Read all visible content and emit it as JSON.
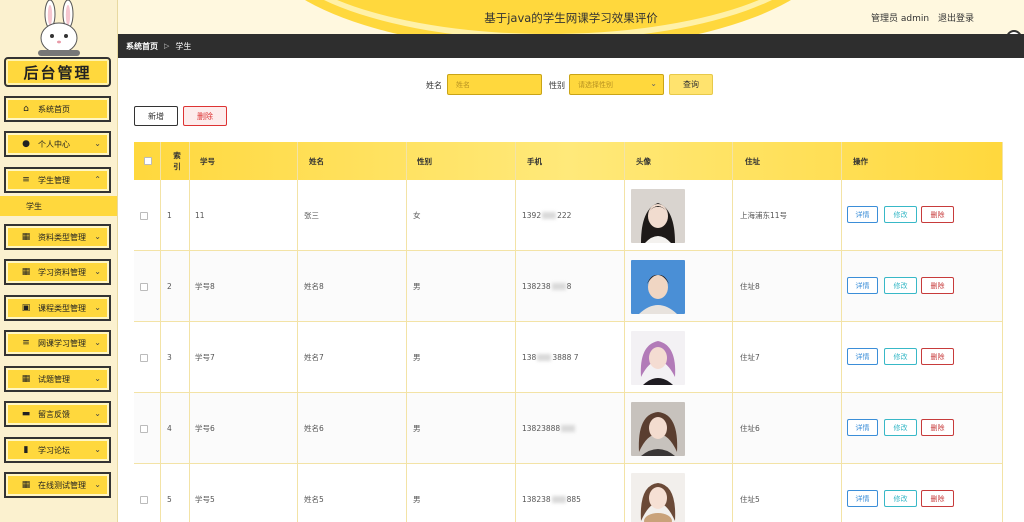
{
  "sidebar": {
    "title": "后台管理",
    "items": [
      {
        "label": "系统首页",
        "icon": "home-icon",
        "glyph": "⌂",
        "expanded": false
      },
      {
        "label": "个人中心",
        "icon": "user-icon",
        "glyph": "●",
        "expanded": false
      },
      {
        "label": "学生管理",
        "icon": "list-icon",
        "glyph": "≡",
        "expanded": true
      },
      {
        "label": "资料类型管理",
        "icon": "grid-icon",
        "glyph": "▦",
        "expanded": false
      },
      {
        "label": "学习资料管理",
        "icon": "grid-icon",
        "glyph": "▦",
        "expanded": false
      },
      {
        "label": "课程类型管理",
        "icon": "clipboard-icon",
        "glyph": "▣",
        "expanded": false
      },
      {
        "label": "网课学习管理",
        "icon": "list-icon",
        "glyph": "≡",
        "expanded": false
      },
      {
        "label": "试题管理",
        "icon": "grid-icon",
        "glyph": "▦",
        "expanded": false
      },
      {
        "label": "留言反馈",
        "icon": "message-icon",
        "glyph": "▬",
        "expanded": false
      },
      {
        "label": "学习论坛",
        "icon": "bar-chart-icon",
        "glyph": "▮",
        "expanded": false
      },
      {
        "label": "在线测试管理",
        "icon": "grid-icon",
        "glyph": "▦",
        "expanded": false
      }
    ],
    "submenu": {
      "label": "学生"
    }
  },
  "header": {
    "title": "基于java的学生网课学习效果评价",
    "user_label": "管理员 admin",
    "logout": "退出登录"
  },
  "breadcrumb": {
    "home": "系统首页",
    "separator": "▷",
    "current": "学生"
  },
  "search": {
    "name_label": "姓名",
    "name_placeholder": "姓名",
    "gender_label": "性别",
    "gender_placeholder": "请选择性别",
    "query": "查询"
  },
  "actions": {
    "add": "新增",
    "delete": "删除"
  },
  "table": {
    "columns": [
      "索引",
      "学号",
      "姓名",
      "性别",
      "手机",
      "头像",
      "住址",
      "操作"
    ],
    "rows": [
      {
        "index": "1",
        "student_no": "11",
        "name": "张三",
        "gender": "女",
        "phone_a": "1392",
        "phone_b": "222",
        "address": "上海浦东11号"
      },
      {
        "index": "2",
        "student_no": "学号8",
        "name": "姓名8",
        "gender": "男",
        "phone_a": "138238",
        "phone_b": "8",
        "address": "住址8"
      },
      {
        "index": "3",
        "student_no": "学号7",
        "name": "姓名7",
        "gender": "男",
        "phone_a": "138",
        "phone_b": "3888 7",
        "address": "住址7"
      },
      {
        "index": "4",
        "student_no": "学号6",
        "name": "姓名6",
        "gender": "男",
        "phone_a": "13823888",
        "phone_b": "",
        "address": "住址6"
      },
      {
        "index": "5",
        "student_no": "学号5",
        "name": "姓名5",
        "gender": "男",
        "phone_a": "138238",
        "phone_b": "885",
        "address": "住址5"
      }
    ],
    "ops": {
      "detail": "详情",
      "edit": "修改",
      "delete": "删除"
    }
  },
  "colors": {
    "accent": "#ffd83d",
    "dark_bar": "#2e2e2e",
    "danger": "#c73b3b",
    "info": "#3b8ed8",
    "teal": "#38b8c7"
  }
}
